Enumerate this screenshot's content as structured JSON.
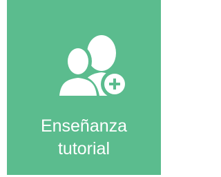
{
  "tile": {
    "label_line1": "Enseñanza",
    "label_line2": "tutorial",
    "icon": "users-add-icon",
    "background_color": "#5bbc8e",
    "foreground_color": "#ffffff"
  }
}
